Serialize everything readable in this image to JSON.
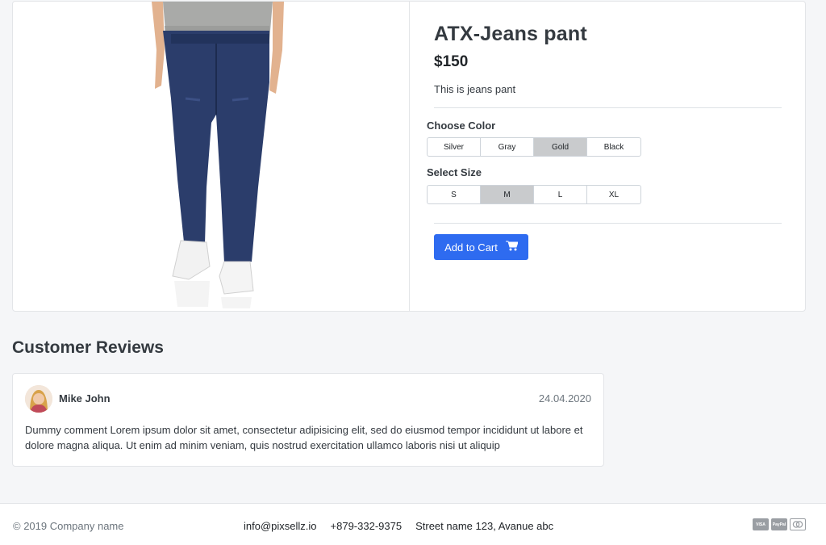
{
  "product": {
    "title": "ATX-Jeans pant",
    "price": "$150",
    "description": "This is jeans pant",
    "color_label": "Choose Color",
    "colors": [
      "Silver",
      "Gray",
      "Gold",
      "Black"
    ],
    "selected_color": "Gold",
    "size_label": "Select Size",
    "sizes": [
      "S",
      "M",
      "L",
      "XL"
    ],
    "selected_size": "M",
    "cart_label": "Add to Cart"
  },
  "reviews": {
    "heading": "Customer Reviews",
    "items": [
      {
        "name": "Mike John",
        "date": "24.04.2020",
        "text": "Dummy comment Lorem ipsum dolor sit amet, consectetur adipisicing elit, sed do eiusmod tempor incididunt ut labore et dolore magna aliqua. Ut enim ad minim veniam, quis nostrud exercitation ullamco laboris nisi ut aliquip"
      }
    ]
  },
  "footer": {
    "copyright": "© 2019 Company name",
    "email": "info@pixsellz.io",
    "phone": "+879-332-9375",
    "address": "Street name 123, Avanue abc",
    "payments": [
      "VISA",
      "PayPal",
      "MC"
    ]
  },
  "colors": {
    "accent": "#2e6bf0",
    "selected_option": "#c9cbcd",
    "denim": "#2b3d6b"
  }
}
